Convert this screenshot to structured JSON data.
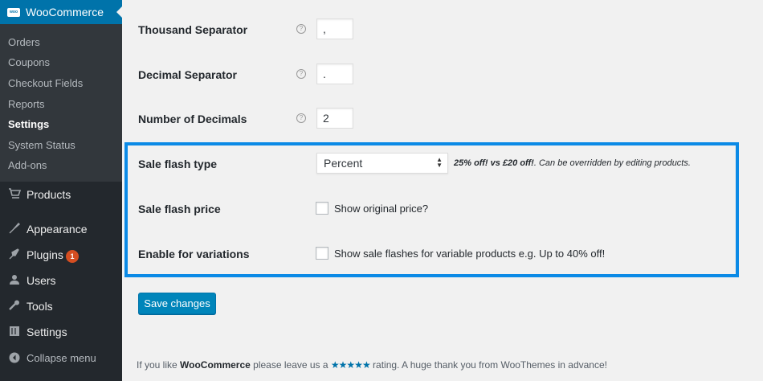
{
  "sidebar": {
    "plugin_title": "WooCommerce",
    "logo_text": "woo",
    "submenu": [
      "Orders",
      "Coupons",
      "Checkout Fields",
      "Reports",
      "Settings",
      "System Status",
      "Add-ons"
    ],
    "current_submenu": "Settings",
    "menu": [
      {
        "label": "Products",
        "icon": "products-icon"
      },
      {
        "label": "Appearance",
        "icon": "appearance-icon"
      },
      {
        "label": "Plugins",
        "icon": "plugins-icon",
        "badge": "1"
      },
      {
        "label": "Users",
        "icon": "users-icon"
      },
      {
        "label": "Tools",
        "icon": "tools-icon"
      },
      {
        "label": "Settings",
        "icon": "settings-icon"
      }
    ],
    "collapse_label": "Collapse menu"
  },
  "settings": {
    "thousand_separator": {
      "label": "Thousand Separator",
      "value": ","
    },
    "decimal_separator": {
      "label": "Decimal Separator",
      "value": "."
    },
    "number_of_decimals": {
      "label": "Number of Decimals",
      "value": "2"
    },
    "sale_flash_type": {
      "label": "Sale flash type",
      "selected": "Percent",
      "desc_bold": "25% off! vs £20 off!",
      "desc_rest": ". Can be overridden by editing products."
    },
    "sale_flash_price": {
      "label": "Sale flash price",
      "checkbox_label": "Show original price?",
      "checked": false
    },
    "enable_variations": {
      "label": "Enable for variations",
      "checkbox_label": "Show sale flashes for variable products e.g. Up to 40% off!",
      "checked": false
    }
  },
  "save_label": "Save changes",
  "footer": {
    "prefix": "If you like ",
    "brand": "WooCommerce",
    "middle": " please leave us a ",
    "stars": "★★★★★",
    "suffix": " rating. A huge thank you from WooThemes in advance!"
  },
  "colors": {
    "accent": "#0073aa",
    "highlight_border": "#0b8ae6",
    "sidebar": "#23282d"
  }
}
